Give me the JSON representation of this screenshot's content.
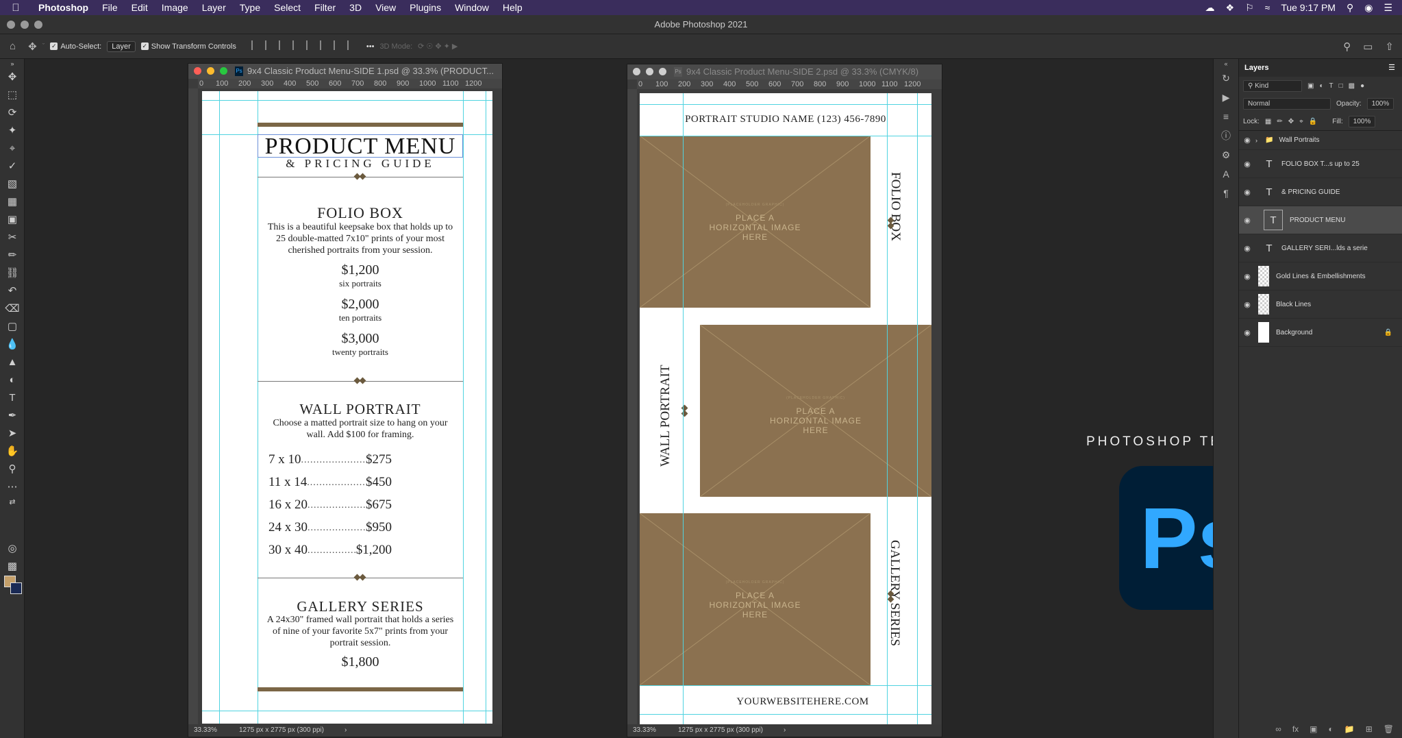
{
  "menubar": {
    "items": [
      "Photoshop",
      "File",
      "Edit",
      "Image",
      "Layer",
      "Type",
      "Select",
      "Filter",
      "3D",
      "View",
      "Plugins",
      "Window",
      "Help"
    ],
    "clock": "Tue 9:17 PM"
  },
  "window_title": "Adobe Photoshop 2021",
  "options": {
    "auto_select": "Auto-Select:",
    "auto_select_value": "Layer",
    "show_transform": "Show Transform Controls",
    "mode_3d": "3D Mode:"
  },
  "doc1": {
    "title": "9x4 Classic Product Menu-SIDE 1.psd @ 33.3% (PRODUCT...",
    "zoom": "33.33%",
    "size": "1275 px x 2775 px (300 ppi)",
    "ruler": [
      "0",
      "100",
      "200",
      "300",
      "400",
      "500",
      "600",
      "700",
      "800",
      "900",
      "1000",
      "1100",
      "1200"
    ],
    "heading": "PRODUCT MENU",
    "subheading": "& PRICING GUIDE",
    "folio_title": "FOLIO BOX",
    "folio_desc": "This is a beautiful keepsake box that holds up to 25 double-matted 7x10\" prints of your most cherished portraits from your session.",
    "folio_prices": [
      {
        "price": "$1,200",
        "label": "six portraits"
      },
      {
        "price": "$2,000",
        "label": "ten portraits"
      },
      {
        "price": "$3,000",
        "label": "twenty portraits"
      }
    ],
    "wall_title": "WALL PORTRAIT",
    "wall_desc": "Choose a matted portrait size to hang on your wall. Add $100 for framing.",
    "wall_sizes": [
      {
        "size": "7 x 10",
        "price": "$275"
      },
      {
        "size": "11 x 14",
        "price": "$450"
      },
      {
        "size": "16 x 20",
        "price": "$675"
      },
      {
        "size": "24 x 30",
        "price": "$950"
      },
      {
        "size": "30 x 40",
        "price": "$1,200"
      }
    ],
    "gallery_title": "GALLERY SERIES",
    "gallery_desc": "A 24x30\" framed wall portrait that holds a series of nine of your favorite 5x7\" prints from your portrait session.",
    "gallery_price": "$1,800"
  },
  "doc2": {
    "title": "9x4 Classic Product Menu-SIDE 2.psd @ 33.3% (CMYK/8)",
    "zoom": "33.33%",
    "size": "1275 px x 2775 px (300 ppi)",
    "ruler": [
      "0",
      "100",
      "200",
      "300",
      "400",
      "500",
      "600",
      "700",
      "800",
      "900",
      "1000",
      "1100",
      "1200"
    ],
    "header": "PORTRAIT STUDIO NAME (123) 456-7890",
    "placeholder": "PLACE A HORIZONTAL IMAGE HERE",
    "placeholder_small": "(PLACEHOLDER GRAPHIC)",
    "side_folio": "FOLIO BOX",
    "side_wall": "WALL PORTRAIT",
    "side_gallery": "GALLERY SERIES",
    "footer": "YOURWEBSITEHERE.COM"
  },
  "layers_panel": {
    "title": "Layers",
    "filter": "Kind",
    "blend": "Normal",
    "opacity_label": "Opacity:",
    "opacity": "100%",
    "lock_label": "Lock:",
    "fill_label": "Fill:",
    "fill": "100%",
    "layers": [
      {
        "name": "Wall Portraits",
        "kind": "group"
      },
      {
        "name": "FOLIO BOX T...s up to 25",
        "kind": "text"
      },
      {
        "name": "& PRICING GUIDE",
        "kind": "text"
      },
      {
        "name": "PRODUCT MENU",
        "kind": "text",
        "selected": true
      },
      {
        "name": "GALLERY SERI...lds a serie",
        "kind": "text"
      },
      {
        "name": "Gold Lines & Embellishments",
        "kind": "pixel"
      },
      {
        "name": "Black Lines",
        "kind": "pixel"
      },
      {
        "name": "Background",
        "kind": "background"
      }
    ]
  },
  "promo": {
    "template_label": "PHOTOSHOP TEMPLATE",
    "logo_text": "Ps"
  },
  "colors": {
    "menubar": "#3a2d5c",
    "gold": "#8b7150",
    "guide": "#4fd3e0",
    "ps_blue": "#31a8ff",
    "ps_bg": "#001e36"
  }
}
